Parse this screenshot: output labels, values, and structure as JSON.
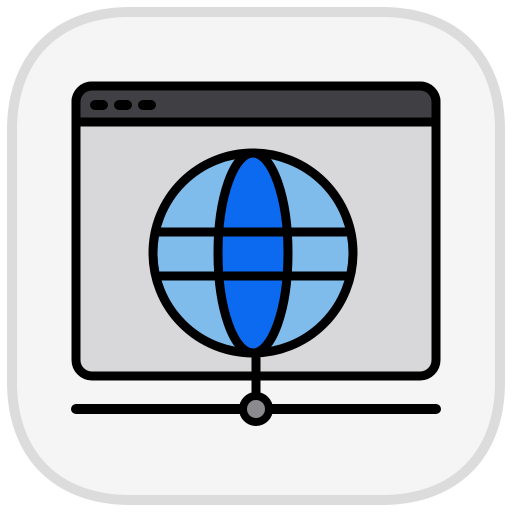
{
  "app_icon": {
    "icon": "web-hosting-network-icon",
    "parts": [
      "rounded-square-tile",
      "browser-window",
      "globe",
      "network-connection-line"
    ]
  },
  "colors": {
    "tile_border": "#dcdcdc",
    "tile_fill": "#f5f5f6",
    "window_titlebar": "#404044",
    "window_body": "#d8d8da",
    "outline": "#000000",
    "globe_light_blue": "#7fbcec",
    "globe_dark_blue": "#0c6af0",
    "node_fill": "#8b8b8f"
  }
}
